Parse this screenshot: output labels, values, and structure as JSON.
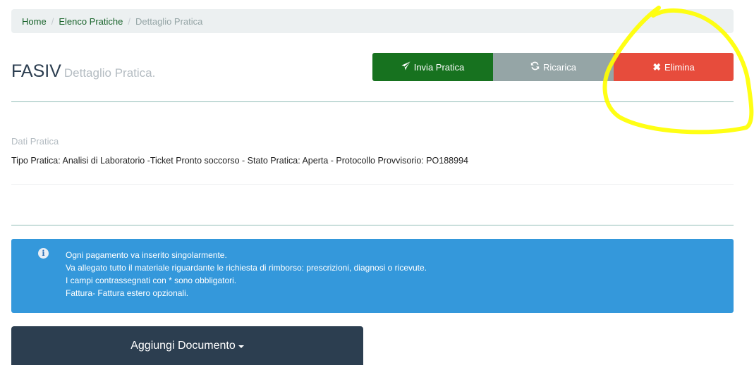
{
  "breadcrumb": {
    "items": [
      {
        "label": "Home"
      },
      {
        "label": "Elenco Pratiche"
      },
      {
        "label": "Dettaglio Pratica"
      }
    ],
    "separator": "/"
  },
  "header": {
    "title": "FASIV",
    "subtitle": "Dettaglio Pratica."
  },
  "actions": {
    "invia": {
      "label": "Invia Pratica",
      "icon": "paper-plane-icon",
      "color": "#17721f"
    },
    "ricarica": {
      "label": "Ricarica",
      "icon": "refresh-icon",
      "color": "#95a5a6"
    },
    "elimina": {
      "label": "Elimina",
      "icon": "close-icon",
      "icon_glyph": "✖",
      "color": "#e74c3c"
    }
  },
  "dati": {
    "label": "Dati Pratica",
    "info": "Tipo Pratica: Analisi di Laboratorio -Ticket Pronto soccorso - Stato Pratica: Aperta - Protocollo Provvisorio: PO188994"
  },
  "alert": {
    "icon": "info-icon",
    "icon_glyph": "i",
    "color": "#3498db",
    "lines": [
      "Ogni pagamento va inserito singolarmente.",
      "Va allegato tutto il materiale riguardante le richiesta di rimborso: prescrizioni, diagnosi o ricevute.",
      "I campi contrassegnati con * sono obbligatori.",
      "Fattura- Fattura estero opzionali."
    ]
  },
  "add_document": {
    "label": "Aggiungi Documento",
    "color": "#2c3e50"
  },
  "annotation": {
    "color": "#ffff00"
  }
}
